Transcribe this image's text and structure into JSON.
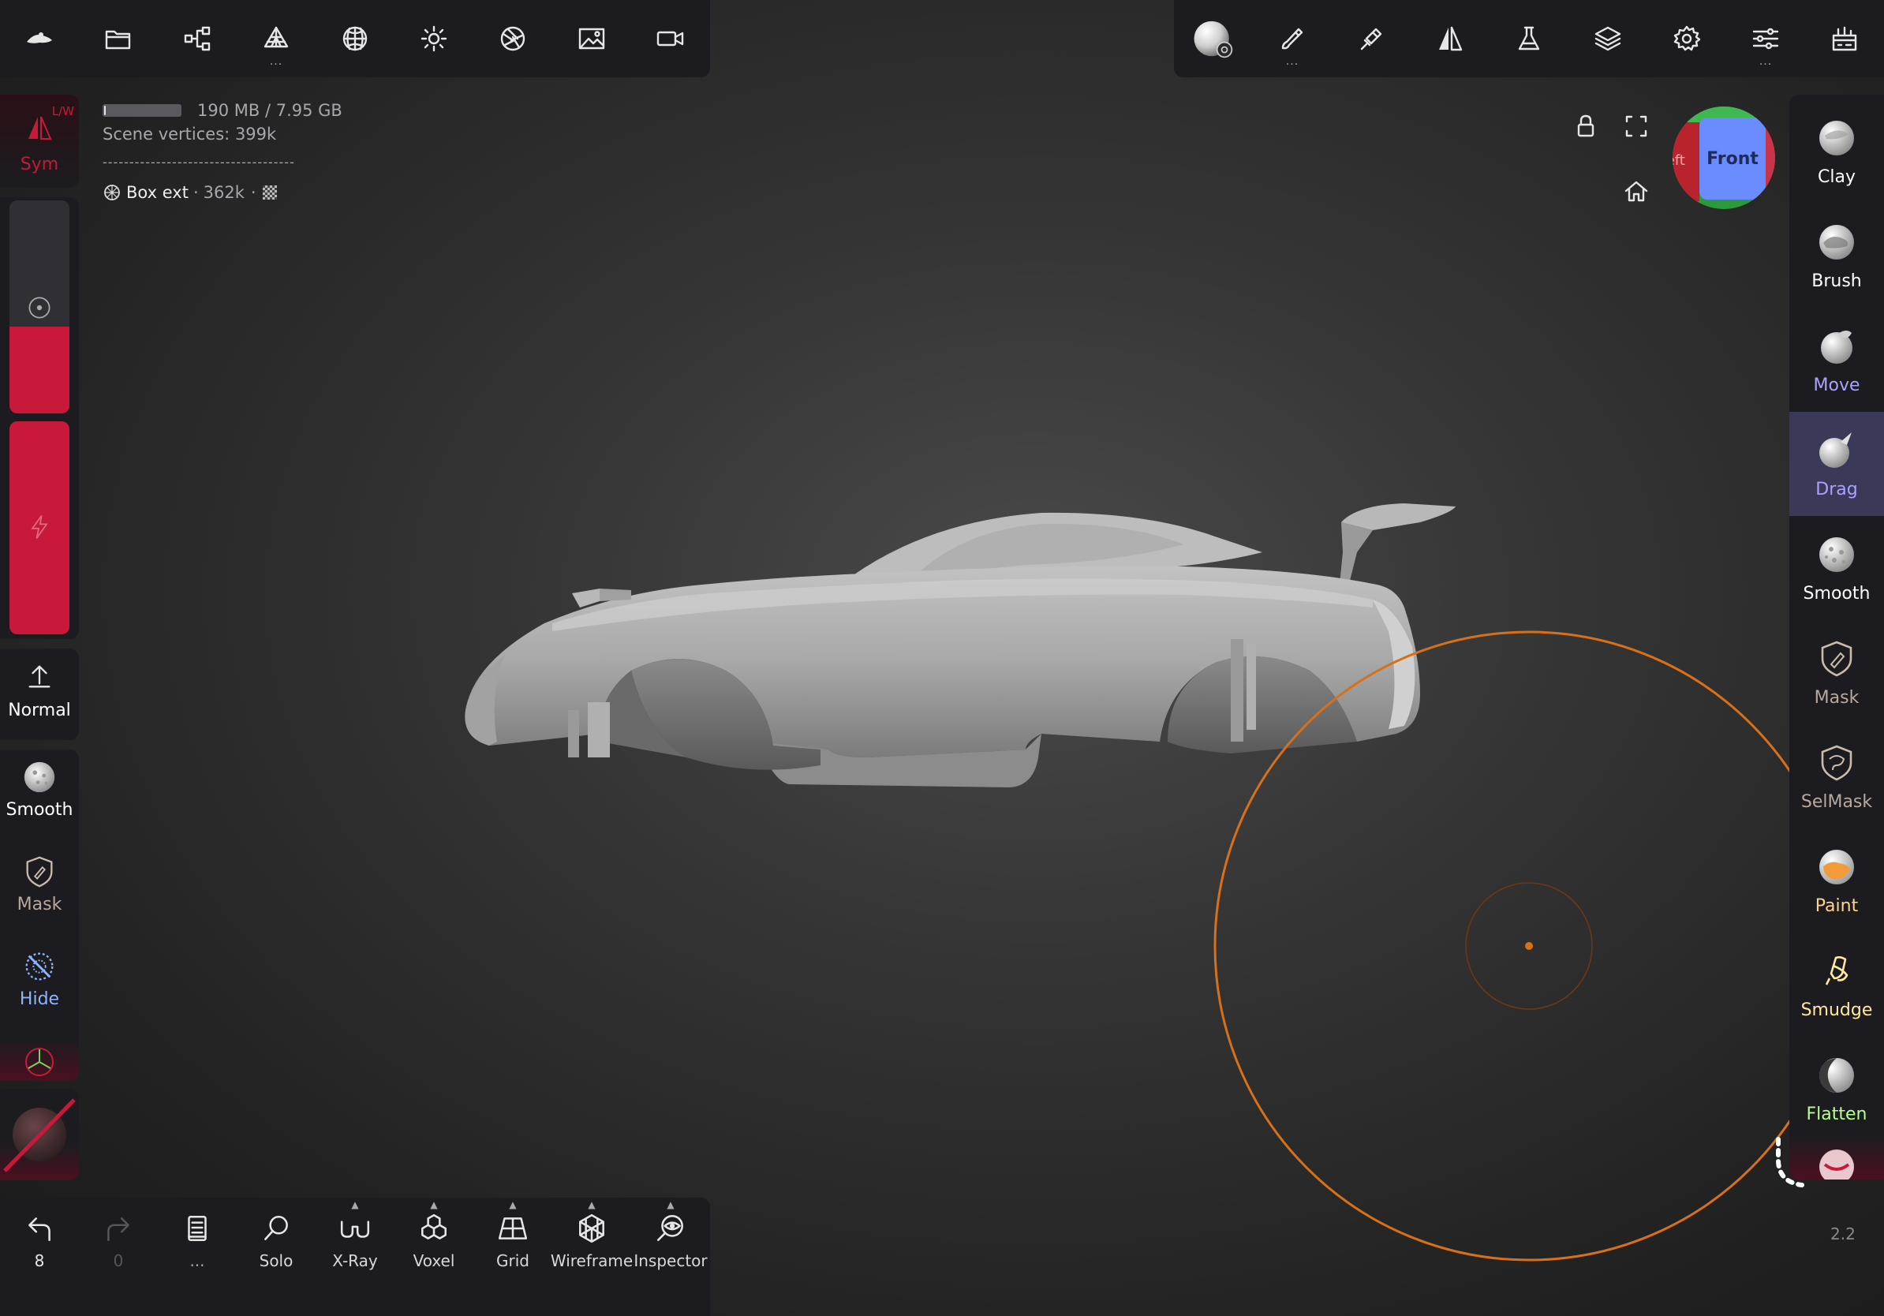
{
  "top_toolbar_left": [
    {
      "icon": "nomad-logo-icon"
    },
    {
      "icon": "folder-icon"
    },
    {
      "icon": "scene-tree-icon"
    },
    {
      "icon": "topology-icon",
      "dots": "..."
    },
    {
      "icon": "background-sphere-icon"
    },
    {
      "icon": "light-icon"
    },
    {
      "icon": "aperture-icon"
    },
    {
      "icon": "image-icon"
    },
    {
      "icon": "camera-icon"
    }
  ],
  "top_toolbar_right": [
    {
      "icon": "material-sphere-icon"
    },
    {
      "icon": "stroke-brush-icon",
      "dots": "..."
    },
    {
      "icon": "painting-brush-icon"
    },
    {
      "icon": "symmetry-icon"
    },
    {
      "icon": "flask-icon"
    },
    {
      "icon": "layers-icon"
    },
    {
      "icon": "settings-gear-icon"
    },
    {
      "icon": "sliders-icon",
      "dots": "..."
    },
    {
      "icon": "interface-icon"
    }
  ],
  "info": {
    "memory": "190 MB / 7.95 GB",
    "vertices_label": "Scene vertices",
    "vertices_value": "399k",
    "separator": "------------------------------------",
    "object_name": "Box ext",
    "object_sep1": "·",
    "object_count": "362k",
    "object_sep2": "·"
  },
  "memory_fraction": 0.02,
  "left_panel": {
    "sym_label": "Sym",
    "sym_badge": "L/W",
    "normal_label": "Normal",
    "smooth_label": "Smooth",
    "mask_label": "Mask",
    "hide_label": "Hide"
  },
  "gizmo": {
    "front_label": "Front",
    "left_label": "Left"
  },
  "right_tools": [
    {
      "label": "Clay",
      "color": "#ffffff",
      "active": false
    },
    {
      "label": "Brush",
      "color": "#ffffff",
      "active": false
    },
    {
      "label": "Move",
      "color": "#a7a3ff",
      "active": false
    },
    {
      "label": "Drag",
      "color": "#a7a3ff",
      "active": true
    },
    {
      "label": "Smooth",
      "color": "#ffffff",
      "active": false
    },
    {
      "label": "Mask",
      "color": "#b8a89c",
      "active": false
    },
    {
      "label": "SelMask",
      "color": "#b8a89c",
      "active": false
    },
    {
      "label": "Paint",
      "color": "#ffd38a",
      "active": false
    },
    {
      "label": "Smudge",
      "color": "#ffe9a0",
      "active": false
    },
    {
      "label": "Flatten",
      "color": "#b6ff8e",
      "active": false
    }
  ],
  "version": "2.2",
  "bottom_bar": [
    {
      "label": "8",
      "icon": "undo-icon"
    },
    {
      "label": "0",
      "icon": "redo-icon"
    },
    {
      "label": "...",
      "icon": "notes-icon"
    },
    {
      "label": "Solo",
      "icon": "search-icon"
    },
    {
      "label": "X-Ray",
      "icon": "xray-glasses-icon"
    },
    {
      "label": "Voxel",
      "icon": "voxel-cubes-icon"
    },
    {
      "label": "Grid",
      "icon": "grid-icon"
    },
    {
      "label": "Wireframe",
      "icon": "wireframe-icon"
    },
    {
      "label": "Inspector",
      "icon": "inspector-eye-icon"
    }
  ],
  "colors": {
    "accent_red": "#c8193a",
    "brush_ring": "#d8701a",
    "panel_bg": "#1c1c20",
    "active_tool_bg": "#3a3a58"
  }
}
